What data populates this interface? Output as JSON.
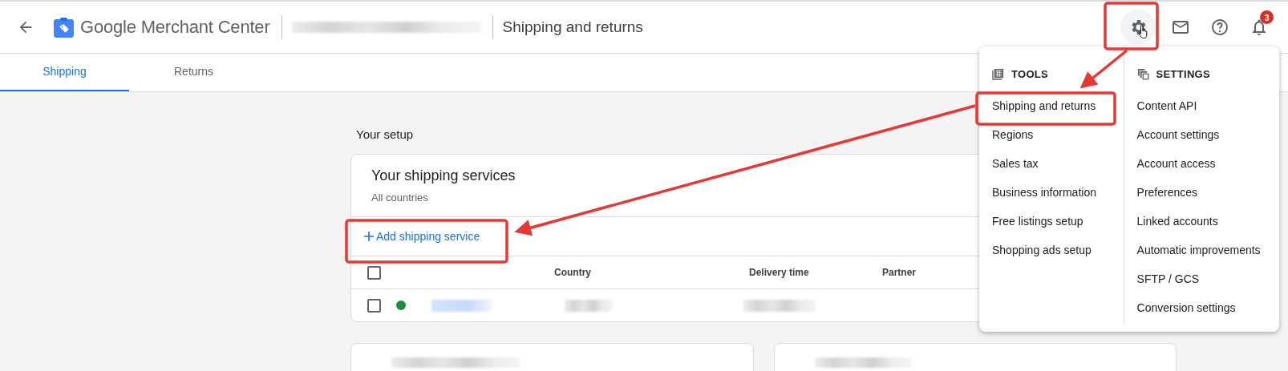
{
  "header": {
    "product": "Google Merchant Center",
    "page_title": "Shipping and returns",
    "settings_active": true,
    "notification_count": "3"
  },
  "tabs": [
    {
      "label": "Shipping",
      "selected": true
    },
    {
      "label": "Returns",
      "selected": false
    }
  ],
  "setup": {
    "heading": "Your setup",
    "card_title": "Your shipping services",
    "card_subtitle": "All countries",
    "add_action": "Add shipping service",
    "columns": [
      "Country",
      "Delivery time",
      "Partner"
    ],
    "header_checked": false,
    "rows": [
      {
        "checked": false,
        "color": "#1e8e3e"
      }
    ]
  },
  "menu": {
    "sections": [
      {
        "kind": "tools",
        "title": "TOOLS",
        "items": [
          "Shipping and returns",
          "Regions",
          "Sales tax",
          "Business information",
          "Free listings setup",
          "Shopping ads setup"
        ]
      },
      {
        "kind": "settings",
        "title": "SETTINGS",
        "items": [
          "Content API",
          "Account settings",
          "Account access",
          "Preferences",
          "Linked accounts",
          "Automatic improvements",
          "SFTP / GCS",
          "Conversion settings"
        ]
      }
    ]
  }
}
